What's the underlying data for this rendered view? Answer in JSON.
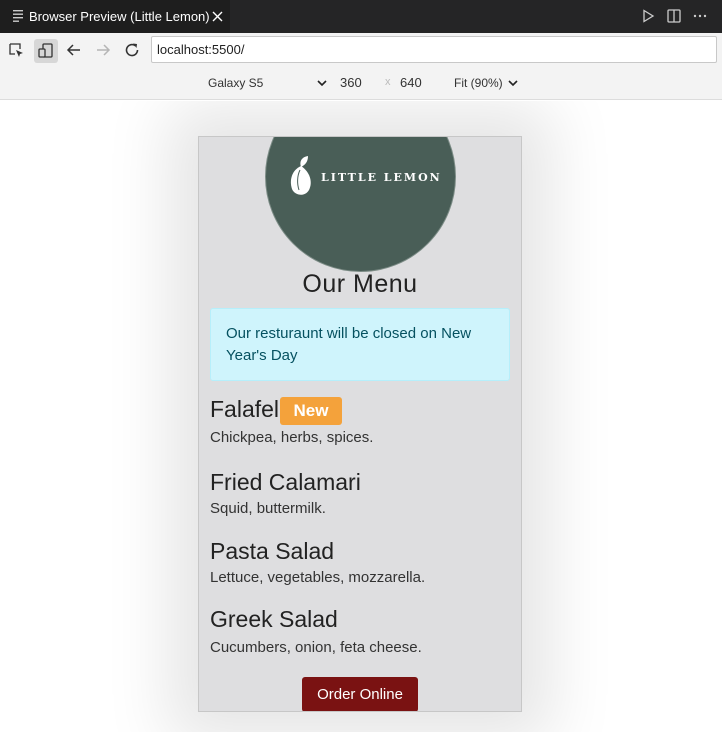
{
  "tab": {
    "title": "Browser Preview (Little Lemon)"
  },
  "address": {
    "url": "localhost:5500/"
  },
  "device": {
    "name": "Galaxy S5",
    "width": "360",
    "separator": "x",
    "height": "640",
    "zoom": "Fit (90%)"
  },
  "page": {
    "logo_text": "LITTLE LEMON",
    "title": "Our Menu",
    "alert": "Our resturaunt will be closed on New Year's Day",
    "badge": "New",
    "items": [
      {
        "name": "Falafel",
        "desc": "Chickpea, herbs, spices."
      },
      {
        "name": "Fried Calamari",
        "desc": "Squid, buttermilk."
      },
      {
        "name": "Pasta Salad",
        "desc": "Lettuce, vegetables, mozzarella."
      },
      {
        "name": "Greek Salad",
        "desc": "Cucumbers, onion, feta cheese."
      }
    ],
    "order_button": "Order Online"
  },
  "colors": {
    "logo_bg": "#495e57",
    "alert_bg": "#cff4fc",
    "badge_bg": "#f4a23b",
    "order_bg": "#7a1212",
    "phone_bg": "#dedee0"
  },
  "icons": [
    "document-icon",
    "close-icon",
    "run-icon",
    "split-editor-icon",
    "more-icon",
    "inspect-icon",
    "device-toggle-icon",
    "back-icon",
    "forward-icon",
    "reload-icon",
    "chevron-down-icon",
    "lemon-leaf-icon"
  ]
}
